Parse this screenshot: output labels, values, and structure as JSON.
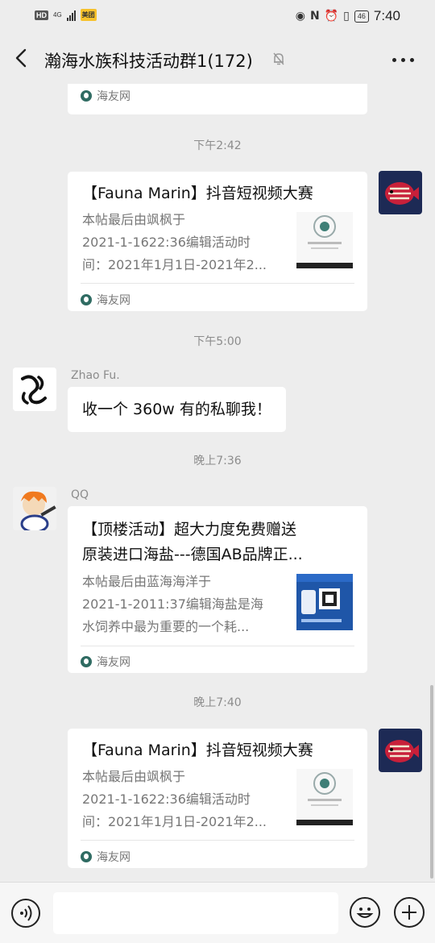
{
  "status_bar": {
    "hd": "HD",
    "network": "4G",
    "app_badge": "美团",
    "battery": "46",
    "time": "7:40"
  },
  "header": {
    "title": "瀚海水族科技活动群1(172)",
    "icons": [
      "back-arrow-icon",
      "mute-bell-icon",
      "more-icon"
    ]
  },
  "messages": [
    {
      "type": "card_partial",
      "source": "海友网"
    },
    {
      "type": "timestamp",
      "text": "下午2:42"
    },
    {
      "type": "link_card",
      "sender": "self",
      "title": "【Fauna Marin】抖音短视频大赛",
      "desc": [
        "本帖最后由飒枫于",
        "2021-1-1622:36编辑活动时",
        "间：2021年1月1日-2021年2..."
      ],
      "source": "海友网"
    },
    {
      "type": "timestamp",
      "text": "下午5:00"
    },
    {
      "type": "text",
      "sender": "Zhao Fu.",
      "text": "收一个 360w 有的私聊我！"
    },
    {
      "type": "timestamp",
      "text": "晚上7:36"
    },
    {
      "type": "link_card",
      "sender": "QQ",
      "title_lines": [
        "【顶楼活动】超大力度免费赠送",
        "原装进口海盐---德国AB品牌正..."
      ],
      "desc": [
        "本帖最后由蓝海海洋于",
        "2021-1-2011:37编辑海盐是海",
        "水饲养中最为重要的一个耗..."
      ],
      "source": "海友网"
    },
    {
      "type": "timestamp",
      "text": "晚上7:40"
    },
    {
      "type": "link_card",
      "sender": "self",
      "title": "【Fauna Marin】抖音短视频大赛",
      "desc": [
        "本帖最后由飒枫于",
        "2021-1-1622:36编辑活动时",
        "间：2021年1月1日-2021年2..."
      ],
      "source": "海友网"
    }
  ],
  "input_bar": {
    "text_value": "",
    "icons": [
      "voice-icon",
      "emoji-icon",
      "plus-icon"
    ]
  }
}
